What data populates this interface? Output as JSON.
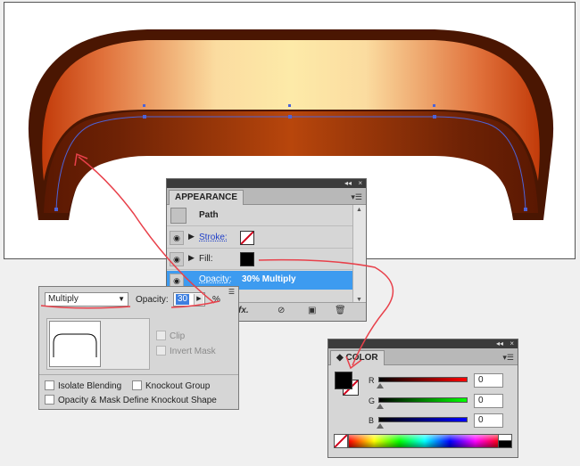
{
  "artwork": {
    "description_icon": "ribbon-banner-shape"
  },
  "appearance": {
    "tab": "APPEARANCE",
    "path_label": "Path",
    "stroke_label": "Stroke:",
    "fill_label": "Fill:",
    "opacity_label": "Opacity:",
    "opacity_value": "30% Multiply",
    "footer_fx": "fx.",
    "colors": {
      "highlight": "#3d9bf0"
    }
  },
  "transparency": {
    "blend_mode": "Multiply",
    "opacity_label": "Opacity:",
    "opacity_value": "30",
    "percent": "%",
    "clip_label": "Clip",
    "invert_mask_label": "Invert Mask",
    "isolate_blending_label": "Isolate Blending",
    "knockout_group_label": "Knockout Group",
    "opacity_mask_label": "Opacity & Mask Define Knockout Shape"
  },
  "color": {
    "tab": "COLOR",
    "r_label": "R",
    "g_label": "G",
    "b_label": "B",
    "r_value": "0",
    "g_value": "0",
    "b_value": "0"
  },
  "annotation_color": "#e8404a"
}
